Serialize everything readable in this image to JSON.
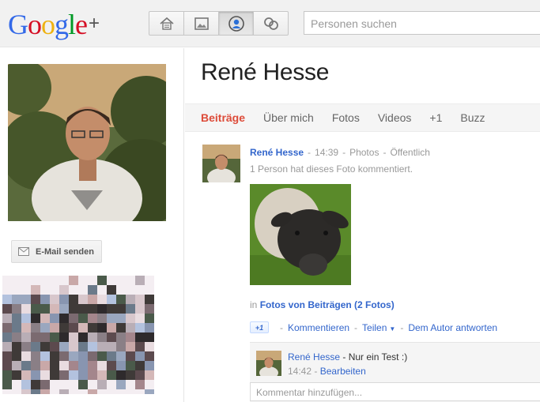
{
  "header": {
    "logo_text": [
      "G",
      "o",
      "o",
      "g",
      "l",
      "e"
    ],
    "logo_plus": "+",
    "nav_icons": [
      "stream-icon",
      "photos-icon",
      "profile-icon",
      "circles-icon"
    ],
    "active_nav": "profile-icon",
    "search_placeholder": "Personen suchen"
  },
  "sidebar": {
    "email_button": "E-Mail senden"
  },
  "profile": {
    "name": "René Hesse",
    "tabs": [
      {
        "label": "Beiträge",
        "active": true
      },
      {
        "label": "Über mich",
        "active": false
      },
      {
        "label": "Fotos",
        "active": false
      },
      {
        "label": "Videos",
        "active": false
      },
      {
        "label": "+1",
        "active": false
      },
      {
        "label": "Buzz",
        "active": false
      }
    ]
  },
  "post": {
    "author": "René Hesse",
    "time": "14:39",
    "source": "Photos",
    "visibility": "Öffentlich",
    "comment_summary": "1 Person hat dieses Foto kommentiert.",
    "album_prefix": "in",
    "album_link": "Fotos von Beiträgen (2 Fotos)",
    "plusone_label": "+1",
    "actions": {
      "comment": "Kommentieren",
      "share": "Teilen",
      "reply": "Dem Autor antworten"
    }
  },
  "comment": {
    "author": "René Hesse",
    "text": " - Nur ein Test :)",
    "time": "14:42",
    "edit": "Bearbeiten",
    "input_placeholder": "Kommentar hinzufügen..."
  },
  "colors": {
    "accent_red": "#dd4b39",
    "link_blue": "#3366cc"
  }
}
